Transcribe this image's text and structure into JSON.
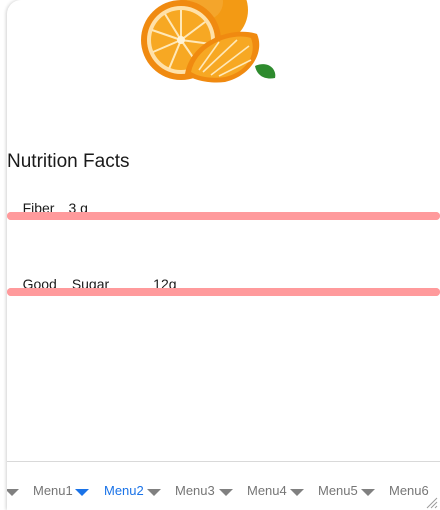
{
  "nutrition": {
    "title": "Nutrition Facts",
    "fiber": {
      "label": "Fiber",
      "value": "3 g",
      "level": 1.0
    },
    "sugar": {
      "rating": "Good",
      "label": "Sugar",
      "value": "12g",
      "level": 1.0
    }
  },
  "menu": {
    "items": [
      "Menu1",
      "Menu2",
      "Menu3",
      "Menu4",
      "Menu5",
      "Menu6"
    ],
    "active": "Menu2"
  },
  "colors": {
    "bar": "#ff9a9c",
    "active_menu": "#1a73e8",
    "menu_text": "#767676"
  },
  "icons": [
    "orange-image",
    "chevron-down-icon",
    "resize-grip-icon"
  ]
}
